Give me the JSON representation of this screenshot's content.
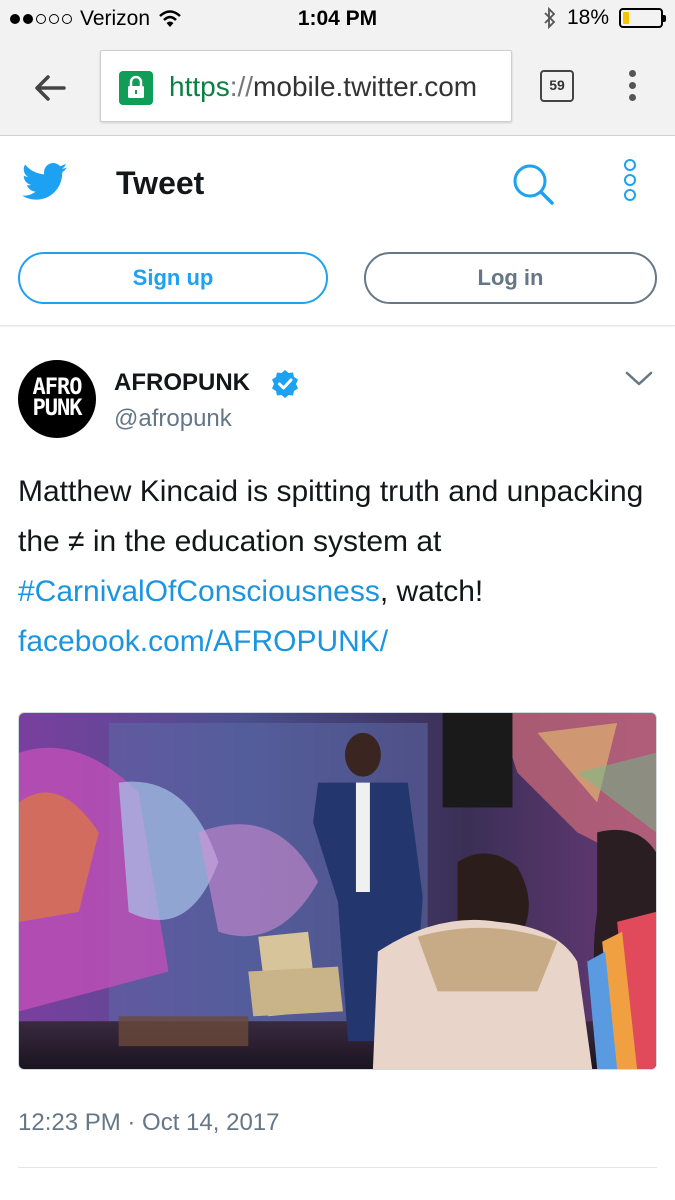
{
  "status_bar": {
    "carrier": "Verizon",
    "time": "1:04 PM",
    "battery": "18%",
    "battery_level": 0.18,
    "signal_bars": 2
  },
  "browser": {
    "url_scheme": "https",
    "url_separator": "://",
    "url_host": "mobile.twitter.com",
    "tab_count": "59"
  },
  "header": {
    "title": "Tweet"
  },
  "auth": {
    "signup_label": "Sign up",
    "login_label": "Log in"
  },
  "tweet": {
    "author_name": "AFROPUNK",
    "author_handle": "@afropunk",
    "avatar_lines": [
      "AFRO",
      "PUNK"
    ],
    "text_before_hashtag": "Matthew Kincaid is spitting truth and unpacking the ≠ in the education system at ",
    "hashtag": "#CarnivalOfConsciousness",
    "text_after_hashtag": ", watch! ",
    "link": "facebook.com/AFROPUNK/",
    "timestamp": "12:23 PM · Oct 14, 2017"
  },
  "colors": {
    "twitter_blue": "#1da1f2",
    "link_blue": "#1b95e0",
    "secure_green": "#0f9d58",
    "muted_gray": "#657786"
  },
  "icons": {
    "back": "arrow-left-icon",
    "lock": "lock-icon",
    "menu": "vertical-dots-icon",
    "logo": "twitter-bird-icon",
    "search": "search-icon",
    "more": "more-icon",
    "verified": "verified-badge-icon",
    "caret": "chevron-down-icon"
  }
}
